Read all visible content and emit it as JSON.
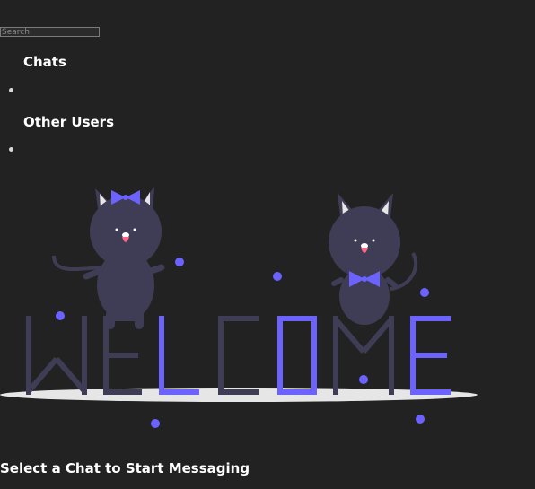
{
  "search": {
    "placeholder": "Search",
    "value": ""
  },
  "sections": {
    "chats": {
      "title": "Chats",
      "items": [
        ""
      ]
    },
    "other_users": {
      "title": "Other Users",
      "items": [
        ""
      ]
    }
  },
  "illustration": {
    "icon": "welcome-cats-illustration",
    "word": "WELCOME",
    "colors": {
      "accent": "#6c63ff",
      "dark": "#3f3d56",
      "shadow": "#e6e6e6",
      "tongue": "#ff6584"
    }
  },
  "footer": {
    "message": "Select a Chat to Start Messaging"
  },
  "colors": {
    "background": "#222222",
    "text": "#ffffff"
  }
}
